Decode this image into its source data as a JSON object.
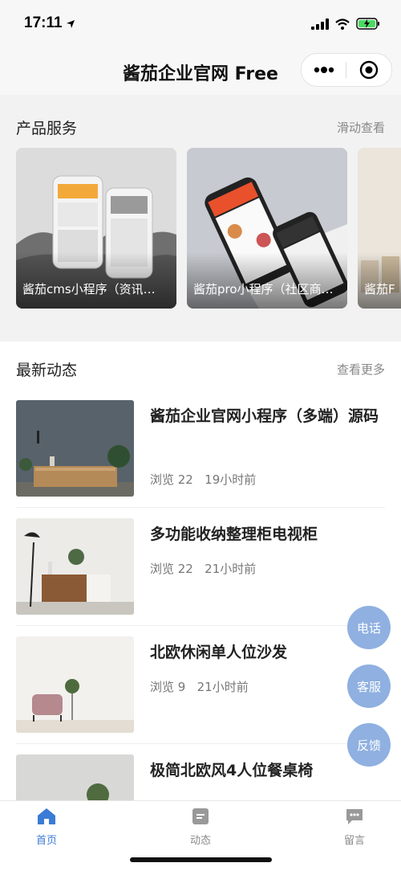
{
  "status": {
    "time": "17:11"
  },
  "nav": {
    "title": "酱茄企业官网 Free"
  },
  "products": {
    "title": "产品服务",
    "more": "滑动查看",
    "cards": [
      {
        "label": "酱茄cms小程序（资讯…"
      },
      {
        "label": "酱茄pro小程序（社区商…"
      },
      {
        "label": "酱茄Fr"
      }
    ]
  },
  "news": {
    "title": "最新动态",
    "more": "查看更多",
    "items": [
      {
        "title": "酱茄企业官网小程序（多端）源码",
        "views": "浏览 22",
        "time": "19小时前"
      },
      {
        "title": "多功能收纳整理柜电视柜",
        "views": "浏览 22",
        "time": "21小时前"
      },
      {
        "title": "北欧休闲单人位沙发",
        "views": "浏览 9",
        "time": "21小时前"
      },
      {
        "title": "极简北欧风4人位餐桌椅",
        "views": "",
        "time": ""
      }
    ]
  },
  "fabs": {
    "phone": "电话",
    "service": "客服",
    "feedback": "反馈"
  },
  "tabs": {
    "home": "首页",
    "feed": "动态",
    "message": "留言"
  },
  "colors": {
    "accent": "#3a7bd5",
    "fab": "#8fb0e0",
    "inactive": "#888888"
  }
}
